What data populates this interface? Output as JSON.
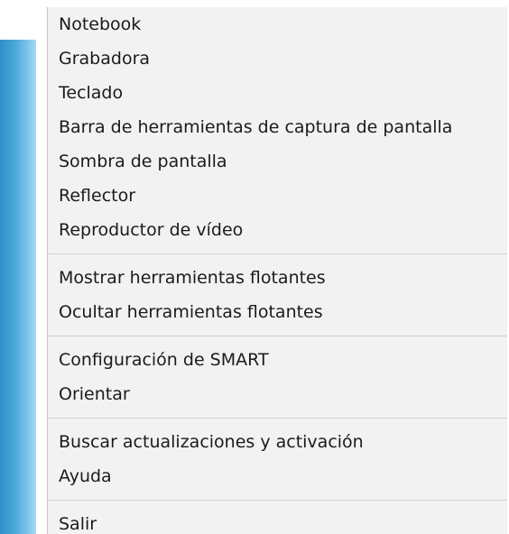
{
  "menu": {
    "groups": [
      {
        "items": [
          {
            "label": "Notebook"
          },
          {
            "label": "Grabadora"
          },
          {
            "label": "Teclado"
          },
          {
            "label": "Barra de herramientas de captura de pantalla"
          },
          {
            "label": "Sombra de pantalla"
          },
          {
            "label": "Reflector"
          },
          {
            "label": "Reproductor de vídeo"
          }
        ]
      },
      {
        "items": [
          {
            "label": "Mostrar herramientas flotantes"
          },
          {
            "label": "Ocultar herramientas flotantes"
          }
        ]
      },
      {
        "items": [
          {
            "label": "Configuración de SMART"
          },
          {
            "label": "Orientar"
          }
        ]
      },
      {
        "items": [
          {
            "label": "Buscar actualizaciones y activación"
          },
          {
            "label": "Ayuda"
          }
        ]
      },
      {
        "items": [
          {
            "label": "Salir"
          }
        ]
      }
    ]
  },
  "colors": {
    "menu_background": "#f2f2f2",
    "side_strip": "#4aa6d8",
    "separator": "#d0d0d0",
    "text": "#1b1b1b"
  }
}
